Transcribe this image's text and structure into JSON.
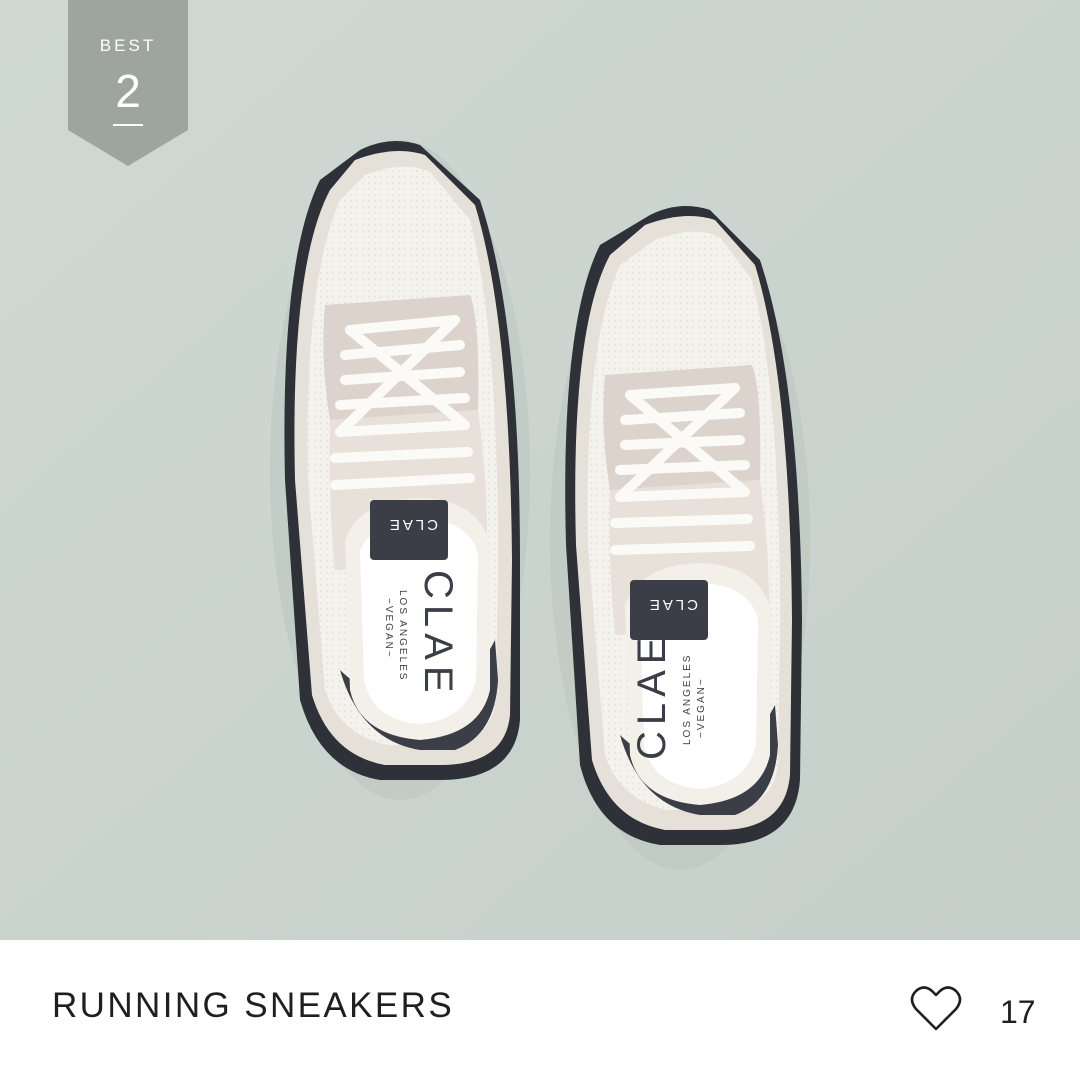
{
  "badge": {
    "label": "BEST",
    "rank": "2"
  },
  "product": {
    "title": "RUNNING SNEAKERS",
    "likes": "17",
    "brand_label": "CLAE",
    "brand_sub": "LOS ANGELES",
    "brand_vegan": "~VEGAN~"
  },
  "icons": {
    "like": "heart-outline-icon"
  },
  "colors": {
    "background": "#c9d3cd",
    "badge": "#9ea5a0",
    "accent_dark": "#3b3e46"
  }
}
